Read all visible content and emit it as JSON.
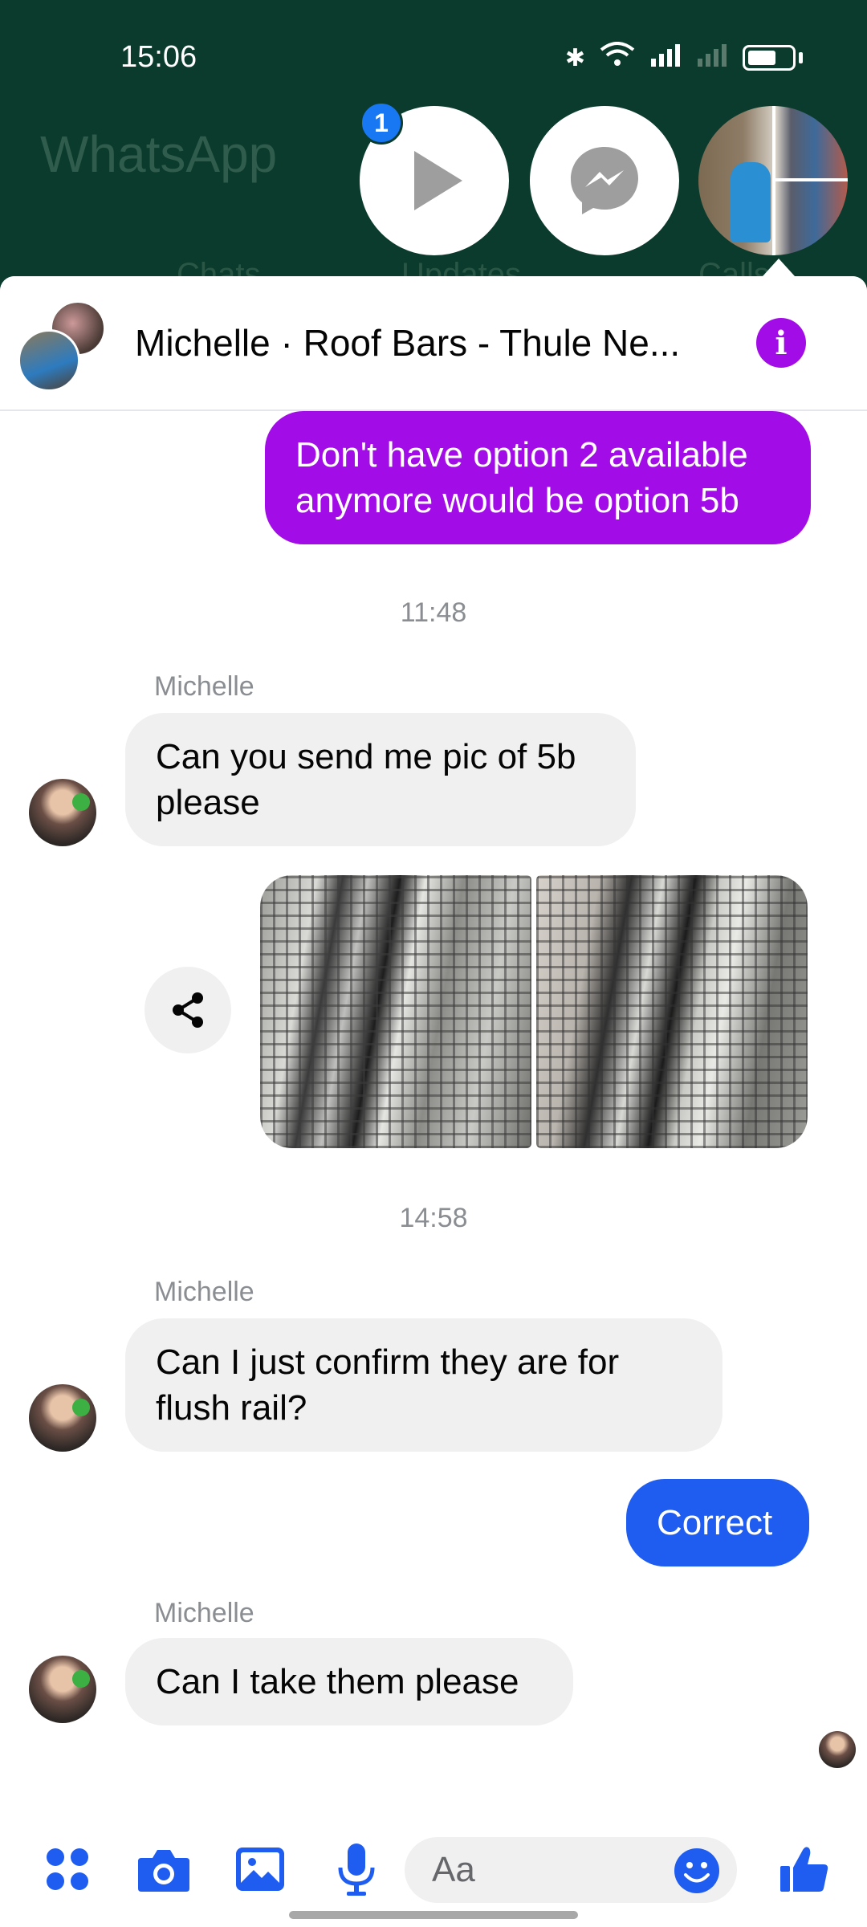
{
  "status_bar": {
    "time": "15:06"
  },
  "background_app": {
    "title": "WhatsApp",
    "tabs": [
      "Chats",
      "Updates",
      "Calls"
    ]
  },
  "chat_heads": {
    "badge_count": "1"
  },
  "conversation": {
    "title": "Michelle · Roof Bars - Thule Ne...",
    "messages": {
      "m1": "Don't have option 2 available anymore would be option 5b",
      "ts1": "11:48",
      "sender1": "Michelle",
      "m2": "Can you send me pic of 5b please",
      "ts2": "14:58",
      "sender2": "Michelle",
      "m3": "Can I just confirm they are for flush rail?",
      "m4": "Correct",
      "sender3": "Michelle",
      "m5": "Can I take them please"
    }
  },
  "composer": {
    "placeholder": "Aa"
  },
  "colors": {
    "accent_purple": "#a20de7",
    "accent_blue": "#1f5cf0",
    "messenger_blue": "#1877f2",
    "incoming_bg": "#f0f0f0",
    "whatsapp_bg": "#0b3b2c"
  },
  "icons": [
    "menu-dots-icon",
    "camera-icon",
    "gallery-icon",
    "microphone-icon",
    "emoji-icon",
    "like-icon",
    "share-icon",
    "info-icon",
    "play-icon",
    "messenger-icon"
  ]
}
